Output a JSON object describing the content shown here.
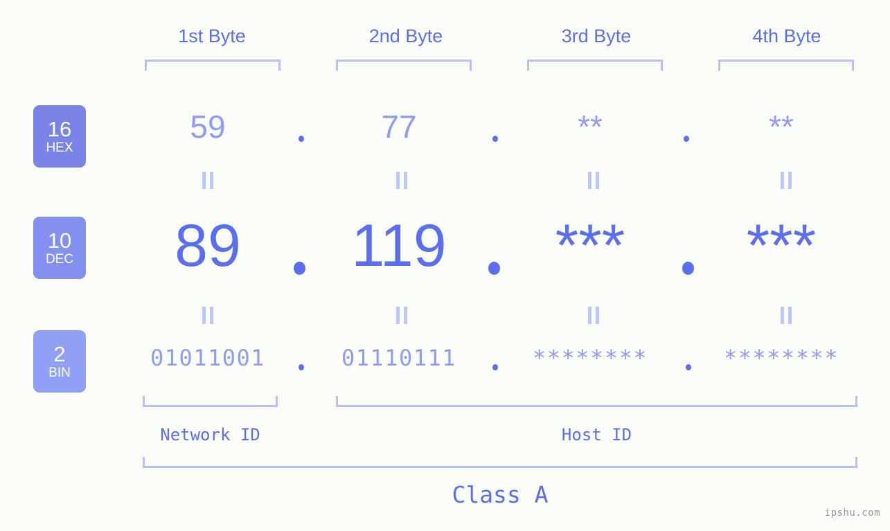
{
  "meta": {
    "watermark": "ipshu.com"
  },
  "header": {
    "byte_labels": [
      {
        "label": "1st Byte"
      },
      {
        "label": "2nd Byte"
      },
      {
        "label": "3rd Byte"
      },
      {
        "label": "4th Byte"
      }
    ]
  },
  "radix_badges": [
    {
      "num": "16",
      "abbr": "HEX",
      "color": "#7a84e6"
    },
    {
      "num": "10",
      "abbr": "DEC",
      "color": "#8490ee"
    },
    {
      "num": "2",
      "abbr": "BIN",
      "color": "#8fa0f6"
    }
  ],
  "rows": {
    "hex": {
      "values": [
        "59",
        "77",
        "**",
        "**"
      ],
      "separator": "."
    },
    "dec": {
      "values": [
        "89",
        "119",
        "***",
        "***"
      ],
      "separator": "."
    },
    "bin": {
      "values": [
        "01011001",
        "01110111",
        "********",
        "********"
      ],
      "separator": "."
    }
  },
  "equal_marks": {
    "glyph": "||"
  },
  "captions": {
    "network_id": "Network ID",
    "host_id": "Host ID",
    "class": "Class A"
  },
  "colors": {
    "background": "#fbfdf9",
    "accent_strong": "#5b6ef0",
    "accent_light": "#8f9cf5",
    "bracket": "#b6bffb",
    "equal_mark": "#bdc6fb",
    "watermark": "#9a9a9a"
  }
}
